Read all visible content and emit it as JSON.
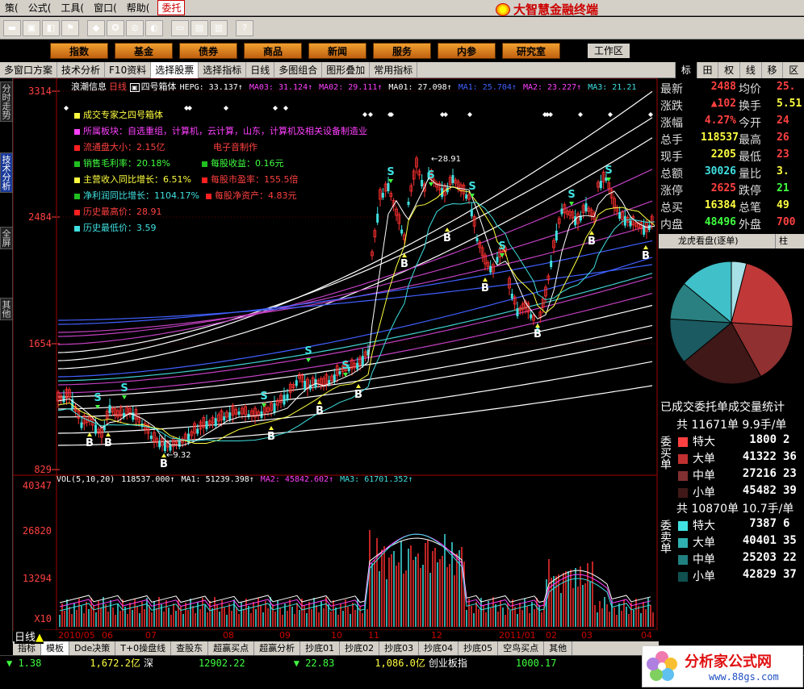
{
  "menu": {
    "items": [
      "策(",
      "公式(",
      "工具(",
      "窗口(",
      "帮助(",
      "委托"
    ]
  },
  "brand": "大智慧金融终端",
  "nav": {
    "buttons": [
      "指数",
      "基金",
      "债券",
      "商品",
      "新闻",
      "服务",
      "内参",
      "研究室"
    ],
    "workspace": "工作区"
  },
  "tabbar": {
    "tabs": [
      "多窗口方案",
      "技术分析",
      "F10资料",
      "选择股票",
      "选择指标",
      "日线",
      "多图组合",
      "图形叠加",
      "常用指标"
    ]
  },
  "rtabs": [
    "标",
    "田",
    "权",
    "线",
    "移",
    "区"
  ],
  "lefttabs": [
    "分时走势",
    "技术分析",
    "全屏",
    "其他"
  ],
  "chart": {
    "title": "浪潮信息",
    "period": "日线",
    "indicator": "四号箱体",
    "ma_header": [
      {
        "t": "HEPG: 33.137↑",
        "c": "#ffffff"
      },
      {
        "t": "MA03: 31.124↑",
        "c": "#ff40ff"
      },
      {
        "t": "MA02: 29.111↑",
        "c": "#ff40ff"
      },
      {
        "t": "MA01: 27.098↑",
        "c": "#ffffff"
      },
      {
        "t": "MA1: 25.704↑",
        "c": "#4060ff"
      },
      {
        "t": "MA2: 23.227↑",
        "c": "#ff40ff"
      },
      {
        "t": "MA3: 21.21",
        "c": "#40e0e0"
      }
    ],
    "y_labels": [
      "3314",
      "2484",
      "1654",
      "829"
    ],
    "high_label": "28.91",
    "low_label": "9.32",
    "x_labels": [
      "2010/05",
      "06",
      "07",
      "08",
      "09",
      "10",
      "11",
      "12",
      "2011/01",
      "02",
      "03",
      "04"
    ],
    "vol_y_labels": [
      "40347",
      "26820",
      "13294",
      "X10"
    ],
    "vol_header": [
      {
        "t": "VOL(5,10,20)",
        "c": "#ffffff"
      },
      {
        "t": "118537.000↑",
        "c": "#ffffff"
      },
      {
        "t": "MA1: 51239.398↑",
        "c": "#ffffff"
      },
      {
        "t": "MA2: 45842.602↑",
        "c": "#ff40ff"
      },
      {
        "t": "MA3: 61701.352↑",
        "c": "#40e0e0"
      }
    ],
    "period_label": "日线"
  },
  "info": [
    {
      "t": "成交专家之四号箱体",
      "c": "#ffff40",
      "sq": "#ffff40"
    },
    {
      "t": "所属板块：自选重组，计算机，云计算，山东，计算机及相关设备制造业",
      "c": "#ff40ff",
      "sq": "#ff40ff"
    },
    {
      "t": "流通盘大小：2.15亿",
      "c": "#ff4040",
      "sq": "#ff2020",
      "t2": "电子音制作",
      "c2": "#ff4040"
    },
    {
      "t": "销售毛利率：20.18%",
      "c": "#40ff40",
      "sq": "#20c020",
      "t2": "每股收益：0.16元",
      "c2": "#40ff40",
      "sq2": "#20c020"
    },
    {
      "t": "主营收入同比增长：6.51%",
      "c": "#ffff40",
      "sq": "#ffff40",
      "t2": "每股市盈率：155.5倍",
      "c2": "#ff4040",
      "sq2": "#ff2020"
    },
    {
      "t": "净利润同比增长：1104.17%",
      "c": "#40e0e0",
      "sq": "#20c020",
      "t2": "每股净资产：4.83元",
      "c2": "#ff4040",
      "sq2": "#ff2020"
    },
    {
      "t": "历史最高价：28.91",
      "c": "#ff4040",
      "sq": "#ff2020"
    },
    {
      "t": "历史最低价：3.59",
      "c": "#40e0e0",
      "sq": "#40e0e0"
    }
  ],
  "quote": [
    {
      "l": "最新",
      "v": "2488",
      "vc": "#ff4040",
      "l2": "均价",
      "v2": "25.",
      "v2c": "#ff4040"
    },
    {
      "l": "涨跌",
      "v": "▲102",
      "vc": "#ff4040",
      "l2": "换手",
      "v2": "5.51",
      "v2c": "#ffff40"
    },
    {
      "l": "涨幅",
      "v": "4.27%",
      "vc": "#ff4040",
      "l2": "今开",
      "v2": "24",
      "v2c": "#ff4040"
    },
    {
      "l": "总手",
      "v": "118537",
      "vc": "#ffff40",
      "l2": "最高",
      "v2": "26",
      "v2c": "#ff4040"
    },
    {
      "l": "现手",
      "v": "2205",
      "vc": "#ffff40",
      "l2": "最低",
      "v2": "23",
      "v2c": "#ff4040"
    },
    {
      "l": "总额",
      "v": "30026",
      "vc": "#40e0e0",
      "l2": "量比",
      "v2": "3.",
      "v2c": "#ffff40"
    },
    {
      "l": "涨停",
      "v": "2625",
      "vc": "#ff4040",
      "l2": "跌停",
      "v2": "21",
      "v2c": "#40ff40"
    },
    {
      "l": "总买",
      "v": "16384",
      "vc": "#ffff40",
      "l2": "总笔",
      "v2": "49",
      "v2c": "#ffff40"
    },
    {
      "l": "内盘",
      "v": "48496",
      "vc": "#40ff40",
      "l2": "外盘",
      "v2": "700",
      "v2c": "#ff4040"
    }
  ],
  "longhu": {
    "title": "龙虎看盘(逐单)",
    "tab2": "柱"
  },
  "pie": {
    "slices": [
      {
        "v": 0.04,
        "c": "#a8e0e8"
      },
      {
        "v": 0.22,
        "c": "#c03838"
      },
      {
        "v": 0.16,
        "c": "#903030"
      },
      {
        "v": 0.22,
        "c": "#401818"
      },
      {
        "v": 0.12,
        "c": "#1a5a60"
      },
      {
        "v": 0.1,
        "c": "#2a8080"
      },
      {
        "v": 0.14,
        "c": "#40c0c8"
      }
    ]
  },
  "orders": {
    "title": "已成交委托单成交量统计",
    "buy": {
      "side": "委买单",
      "summary": "共 11671单 9.9手/单",
      "rows": [
        {
          "l": "特大",
          "v": "1800",
          "v2": "2",
          "c": "#ff4040"
        },
        {
          "l": "大单",
          "v": "41322",
          "v2": "36",
          "c": "#c03030"
        },
        {
          "l": "中单",
          "v": "27216",
          "v2": "23",
          "c": "#803030"
        },
        {
          "l": "小单",
          "v": "45482",
          "v2": "39",
          "c": "#401818"
        }
      ]
    },
    "sell": {
      "side": "委卖单",
      "summary": "共 10870单 10.7手/单",
      "rows": [
        {
          "l": "特大",
          "v": "7387",
          "v2": "6",
          "c": "#40e0e0"
        },
        {
          "l": "大单",
          "v": "40401",
          "v2": "35",
          "c": "#30b0b0"
        },
        {
          "l": "中单",
          "v": "25203",
          "v2": "22",
          "c": "#208080"
        },
        {
          "l": "小单",
          "v": "42829",
          "v2": "37",
          "c": "#105050"
        }
      ]
    }
  },
  "bottom_tabs": [
    "指标",
    "模板",
    "Dde决策",
    "T+0操盘线",
    "查股东",
    "超赢买点",
    "超赢分析",
    "抄底01",
    "抄底02",
    "抄底03",
    "抄底04",
    "抄底05",
    "空鸟买点",
    "其他"
  ],
  "status": [
    {
      "t": "▼ 1.38",
      "c": "#40ff40"
    },
    {
      "t": "1,672.2亿",
      "c": "#ffff40"
    },
    {
      "t": "深",
      "c": "#ffffff"
    },
    {
      "t": "12902.22",
      "c": "#40ff40"
    },
    {
      "t": "▼ 22.83",
      "c": "#40ff40"
    },
    {
      "t": "1,086.0亿",
      "c": "#ffff40"
    },
    {
      "t": "创业板指",
      "c": "#ffffff"
    },
    {
      "t": "1000.17",
      "c": "#40ff40"
    }
  ],
  "watermark": {
    "text": "分析家公式网",
    "url": "www.88gs.com"
  }
}
